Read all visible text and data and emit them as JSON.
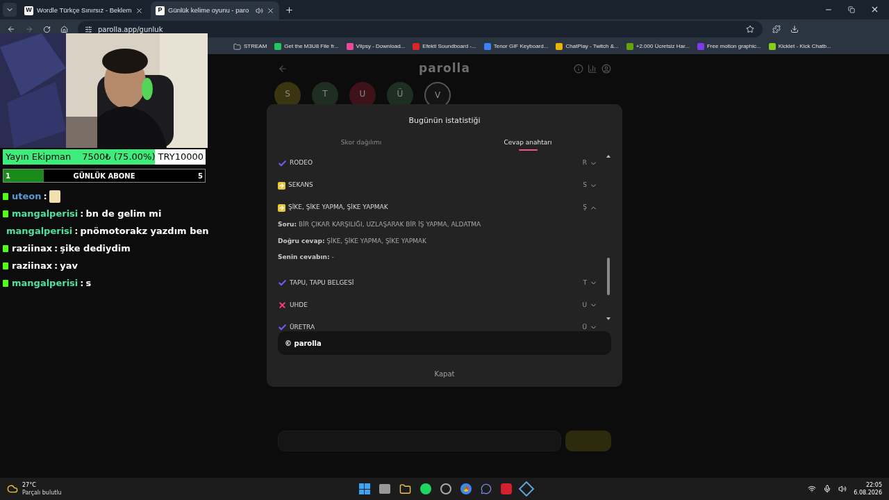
{
  "browser": {
    "tabs": [
      {
        "title": "Wordle Türkçe Sınırsız - Beklem",
        "favicon": "W",
        "selected": false,
        "audio": false
      },
      {
        "title": "Günlük kelime oyunu - paro",
        "favicon": "P",
        "selected": true,
        "audio": true
      }
    ],
    "address": "parolla.app/gunluk",
    "bookmarks": [
      {
        "label": "STREAM",
        "kind": "folder"
      },
      {
        "label": "Get the M3U8 File fr...",
        "color": "#22c55e"
      },
      {
        "label": "Vlipsy - Download...",
        "color": "#ec4899"
      },
      {
        "label": "Efekti Soundboard -...",
        "color": "#dc2626"
      },
      {
        "label": "Tenor GIF Keyboard...",
        "color": "#3b82f6"
      },
      {
        "label": "ChatPlay - Twitch &...",
        "color": "#eab308"
      },
      {
        "label": "+2.000 Ücretsiz Har...",
        "color": "#65a30d"
      },
      {
        "label": "Free motion graphic...",
        "color": "#7c3aed"
      },
      {
        "label": "Kicklet - Kick Chatb...",
        "color": "#84cc16"
      }
    ]
  },
  "page": {
    "logo": "parolla",
    "circles": [
      {
        "color": "#3a3510",
        "letter": "S",
        "current": false
      },
      {
        "color": "#1e2e22",
        "letter": "T",
        "current": false
      },
      {
        "color": "#3d1218",
        "letter": "U",
        "current": false
      },
      {
        "color": "#1e2e22",
        "letter": "Ü",
        "current": false
      },
      {
        "color": "#141414",
        "letter": "V",
        "current": true
      }
    ]
  },
  "modal": {
    "title": "Bugünün istatistiği",
    "tabs": [
      {
        "label": "Skor dağılımı",
        "selected": false
      },
      {
        "label": "Cevap anahtarı",
        "selected": true
      }
    ],
    "answers": [
      {
        "kind": "correct",
        "word": "RODEO",
        "letter": "R",
        "expanded": false
      },
      {
        "kind": "pass",
        "word": "SEKANS",
        "letter": "S",
        "expanded": false
      },
      {
        "kind": "pass",
        "word": "ŞİKE, ŞİKE YAPMA, ŞİKE YAPMAK",
        "letter": "Ş",
        "expanded": true,
        "details": [
          "**Soru:** BİR ÇIKAR KARŞILIĞI, UZLAŞARAK BİR İŞ YAPMA, ALDATMA",
          "**Doğru cevap:** ŞİKE, ŞİKE YAPMA, ŞİKE YAPMAK",
          "**Senin cevabın:** -"
        ]
      },
      {
        "kind": "correct",
        "word": "TAPU, TAPU BELGESİ",
        "letter": "T",
        "expanded": false
      },
      {
        "kind": "wrong",
        "word": "UHDE",
        "letter": "U",
        "expanded": false
      },
      {
        "kind": "correct",
        "word": "ÜRETRA",
        "letter": "Ü",
        "expanded": false
      }
    ],
    "footer": "© parolla",
    "close": "Kapat"
  },
  "overlay": {
    "goal": {
      "label": "Yayın Ekipman",
      "amount": "7500₺ (75.00%)",
      "target": "TRY10000",
      "level": 0.75
    },
    "subs": {
      "start": "1",
      "label": "GÜNLÜK ABONE",
      "end": "5",
      "level": 0.2
    },
    "chat": [
      {
        "user": "uteon",
        "color": "#5b9bd5",
        "separator": ":",
        "kind": "emote"
      },
      {
        "user": "mangalperisi",
        "color": "#4ee1a0",
        "separator": ":",
        "kind": "text",
        "text": "bn de gelim mi"
      },
      {
        "user": "mangalperisi",
        "color": "#4ee1a0",
        "separator": ":",
        "kind": "text",
        "text": "pnömotorakz yazdım ben"
      },
      {
        "user": "raziinax",
        "color": "#ffffff",
        "separator": ":",
        "kind": "text",
        "text": "şike dediydim"
      },
      {
        "user": "raziinax",
        "color": "#ffffff",
        "separator": ":",
        "kind": "text",
        "text": "yav"
      },
      {
        "user": "mangalperisi",
        "color": "#4ee1a0",
        "separator": ":",
        "kind": "text",
        "text": "s"
      }
    ]
  },
  "taskbar": {
    "temperature": "27°C",
    "weather": "Parçalı bulutlu",
    "time": "22:05",
    "date": "6.08.2026"
  }
}
